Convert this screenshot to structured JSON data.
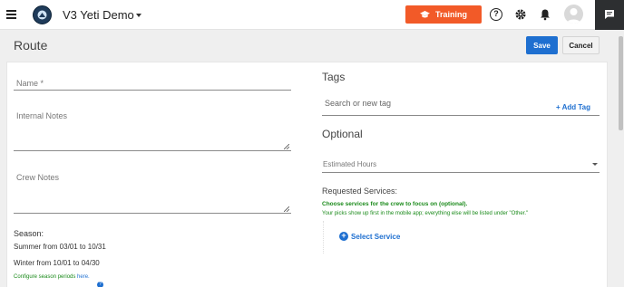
{
  "header": {
    "app_title": "V3 Yeti Demo",
    "training_label": "Training",
    "help_symbol": "?"
  },
  "page": {
    "title": "Route",
    "save_label": "Save",
    "cancel_label": "Cancel"
  },
  "form": {
    "name_label": "Name  *",
    "internal_notes_label": "Internal Notes",
    "crew_notes_label": "Crew Notes",
    "season_heading": "Season:",
    "season_summer": "Summer from 03/01 to 10/31",
    "season_winter": "Winter from 10/01 to 04/30",
    "configure_text": "Configure season periods ",
    "configure_link": "here."
  },
  "tags": {
    "heading": "Tags",
    "search_placeholder": "Search or new tag",
    "add_tag_label": "Add Tag",
    "add_tag_symbol": "+"
  },
  "optional": {
    "heading": "Optional",
    "estimated_hours_label": "Estimated Hours",
    "requested_services_heading": "Requested Services:",
    "services_hint_bold": "Choose services for the crew to focus on (optional).",
    "services_hint": "Your picks show up first in the mobile app; everything else will be listed under \"Other.\"",
    "select_service_label": "Select Service",
    "select_service_symbol": "+"
  },
  "icons": {
    "menu": "hamburger-icon",
    "logo": "yeti-logo",
    "help": "help-icon",
    "settings": "gear-icon",
    "notifications": "bell-icon",
    "chat": "chat-icon",
    "training": "graduation-cap-icon"
  },
  "colors": {
    "training": "#f25a28",
    "primary": "#1e6fd0",
    "hint_green": "#1a8a1a"
  }
}
